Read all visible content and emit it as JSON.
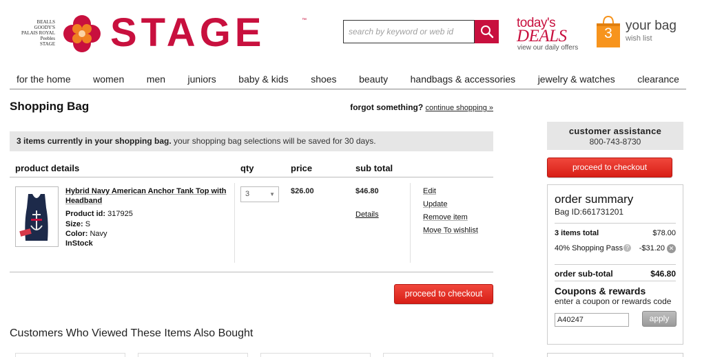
{
  "header": {
    "brand_stack": [
      "BEALLS",
      "GOODY'S",
      "PALAIS ROYAL",
      "Peebles",
      "STAGE"
    ],
    "logo_text": "STAGE",
    "logo_tm": "™",
    "search_placeholder": "search by keyword or web id",
    "deals_line1": "today's",
    "deals_line2": "DEALS",
    "deals_line3": "view our daily offers",
    "bag_count": "3",
    "bag_label": "your bag",
    "wish_label": "wish list",
    "colors": {
      "brand_red": "#c8103e",
      "bag_orange": "#f7941d"
    }
  },
  "nav": [
    "for the home",
    "women",
    "men",
    "juniors",
    "baby & kids",
    "shoes",
    "beauty",
    "handbags & accessories",
    "jewelry & watches",
    "clearance"
  ],
  "bag": {
    "title": "Shopping Bag",
    "forgot_label": "forgot something?",
    "continue_link": "continue shopping »",
    "banner_bold": "3 items currently in your shopping bag.",
    "banner_rest": " your shopping bag selections will be saved for 30 days.",
    "columns": [
      "product details",
      "qty",
      "price",
      "sub total"
    ],
    "item": {
      "name": "Hybrid Navy American Anchor Tank Top with Headband",
      "product_id_label": "Product id:",
      "product_id": "317925",
      "size_label": "Size:",
      "size": "S",
      "color_label": "Color:",
      "color": "Navy",
      "stock": "InStock",
      "qty": "3",
      "price": "$26.00",
      "subtotal": "$46.80",
      "details_link": "Details",
      "actions": [
        "Edit",
        "Update",
        "Remove item",
        "Move To wishlist"
      ]
    },
    "checkout_label": "proceed to checkout",
    "also_bought": "Customers Who Viewed These Items Also Bought"
  },
  "sidebar": {
    "assist_title": "customer assistance",
    "assist_phone": "800-743-8730",
    "checkout_label": "proceed to checkout",
    "summary": {
      "title": "order summary",
      "bag_id": "Bag ID:661731201",
      "items_label": "3  items total",
      "items_value": "$78.00",
      "promo_label": "40% Shopping Pass",
      "promo_value": "-$31.20",
      "subtotal_label": "order sub-total",
      "subtotal_value": "$46.80",
      "coupons_title": "Coupons & rewards",
      "coupons_sub": "enter a coupon or rewards code",
      "coupon_value": "A40247",
      "apply_label": "apply"
    }
  }
}
